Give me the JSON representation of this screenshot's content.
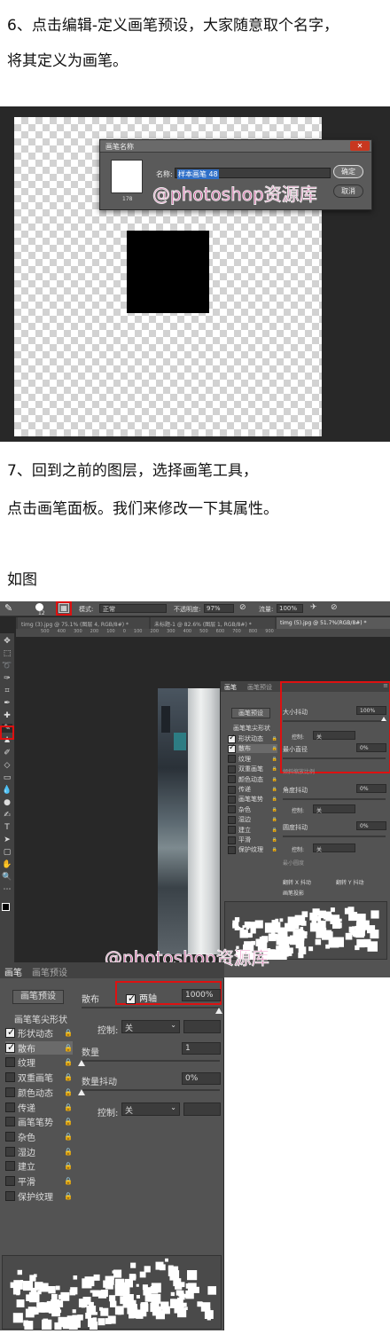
{
  "step6": {
    "line1": "6、点击编辑-定义画笔预设，大家随意取个名字，",
    "line2": "将其定义为画笔。"
  },
  "dialog": {
    "title": "画笔名称",
    "name_label": "名称:",
    "name_value": "样本画笔 48",
    "size": "178",
    "ok": "确定",
    "cancel": "取消"
  },
  "step7": {
    "line1": "7、回到之前的图层，选择画笔工具，",
    "line2": "点击画笔面板。我们来修改一下其属性。"
  },
  "as_shown": "如图",
  "watermark": "@photoshop资源库",
  "optionsbar": {
    "size": "12",
    "mode_label": "模式:",
    "mode_value": "正常",
    "opacity_label": "不透明度:",
    "opacity_value": "97%",
    "flow_label": "流量:",
    "flow_value": "100%"
  },
  "doc_tabs": [
    "timg (3).jpg @ 75.1% (图层 4, RGB/8#) *",
    "未标题-1 @ 82.6% (图层 1, RGB/8#) *",
    "timg (5).jpg @ 51.7%(RGB/8#) *"
  ],
  "ruler": [
    "500",
    "400",
    "300",
    "200",
    "100",
    "0",
    "100",
    "200",
    "300",
    "400",
    "500",
    "600",
    "700",
    "800",
    "900"
  ],
  "brush_panel": {
    "tabs": [
      "画笔",
      "画笔预设"
    ],
    "preset_button": "画笔预设",
    "tip_shape": "画笔笔尖形状",
    "items": [
      {
        "label": "形状动态",
        "checked": true
      },
      {
        "label": "散布",
        "checked": true
      },
      {
        "label": "纹理",
        "checked": false
      },
      {
        "label": "双重画笔",
        "checked": false
      },
      {
        "label": "颜色动态",
        "checked": false
      },
      {
        "label": "传递",
        "checked": false
      },
      {
        "label": "画笔笔势",
        "checked": false
      },
      {
        "label": "杂色",
        "checked": false
      },
      {
        "label": "湿边",
        "checked": false
      },
      {
        "label": "建立",
        "checked": false
      },
      {
        "label": "平滑",
        "checked": false
      },
      {
        "label": "保护纹理",
        "checked": false
      }
    ],
    "small": {
      "size_jitter_label": "大小抖动",
      "size_jitter": "100%",
      "control_label": "控制:",
      "control_value": "关",
      "min_diameter_label": "最小直径",
      "min_diameter": "0%",
      "tilt_scale_label": "倾斜缩放比例",
      "angle_jitter_label": "角度抖动",
      "angle_jitter": "0%",
      "roundness_jitter_label": "圆度抖动",
      "roundness_jitter": "0%",
      "min_roundness_label": "最小圆度",
      "flip_x": "翻转 X 抖动",
      "flip_y": "翻转 Y 抖动",
      "projection": "画笔投影"
    },
    "big": {
      "scatter_label": "散布",
      "both_axes_label": "两轴",
      "scatter_value": "1000%",
      "control_label": "控制:",
      "control_value": "关",
      "count_label": "数量",
      "count_value": "1",
      "count_jitter_label": "数量抖动",
      "count_jitter": "0%"
    }
  }
}
